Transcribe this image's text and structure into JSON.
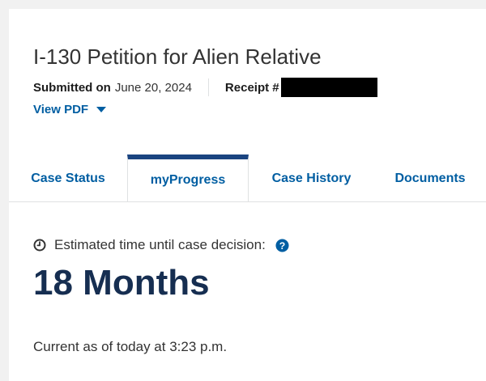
{
  "case": {
    "title": "I-130 Petition for Alien Relative",
    "submitted_label": "Submitted on",
    "submitted_date": "June 20, 2024",
    "receipt_label": "Receipt #",
    "view_pdf_label": "View PDF"
  },
  "tabs": [
    {
      "label": "Case Status",
      "active": false
    },
    {
      "label": "myProgress",
      "active": true
    },
    {
      "label": "Case History",
      "active": false
    },
    {
      "label": "Documents",
      "active": false
    }
  ],
  "progress": {
    "estimate_label": "Estimated time until case decision:",
    "estimate_value": "18 Months",
    "current_as_of": "Current as of today at 3:23 p.m."
  },
  "icons": {
    "clock": "clock-icon",
    "help": "question-circle-icon",
    "dropdown": "caret-down-icon"
  },
  "colors": {
    "link": "#005ea2",
    "active_tab_border": "#1a4480",
    "big_value": "#162e51"
  }
}
